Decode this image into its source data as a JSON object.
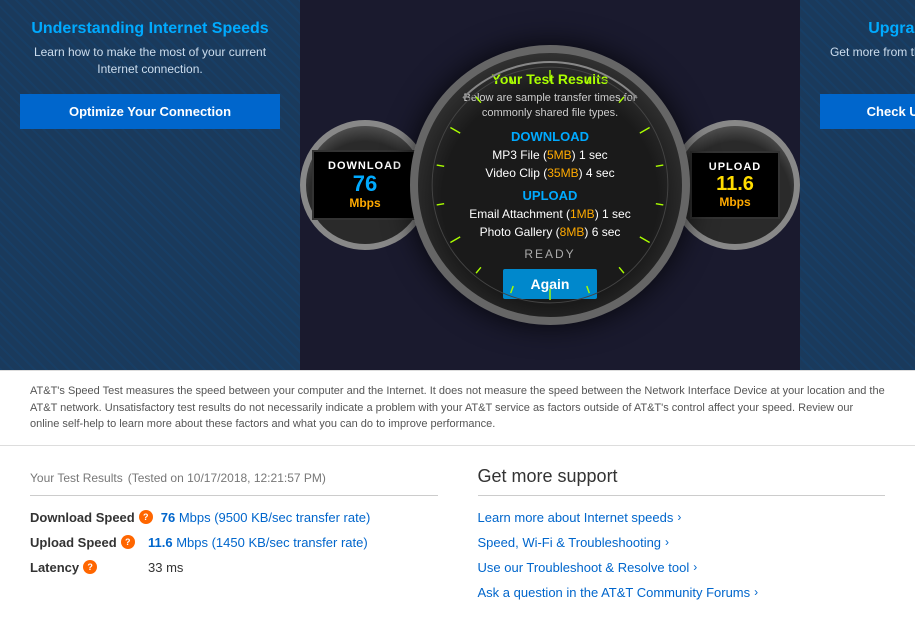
{
  "left_panel": {
    "title": "Understanding Internet Speeds",
    "description": "Learn how to make the most of your current Internet connection.",
    "button_label": "Optimize Your Connection"
  },
  "right_panel": {
    "title": "Upgrade your service",
    "description": "Get more from the Internet and increase your speed.",
    "button_label": "Check Upgrade Availability"
  },
  "gauge": {
    "title": "Your Test Results",
    "subtitle": "Below are sample transfer times for commonly shared file types.",
    "download_label": "DOWNLOAD",
    "download_files": [
      {
        "name": "MP3 File",
        "size": "5MB",
        "time": "1 sec"
      },
      {
        "name": "Video Clip",
        "size": "35MB",
        "time": "4 sec"
      }
    ],
    "upload_label": "UPLOAD",
    "upload_files": [
      {
        "name": "Email Attachment",
        "size": "1MB",
        "time": "1 sec"
      },
      {
        "name": "Photo Gallery",
        "size": "8MB",
        "time": "6 sec"
      }
    ],
    "ready_label": "READY",
    "again_button": "Again",
    "download_speed": "76",
    "download_unit": "Mbps",
    "download_display": "DOWNLOAD",
    "upload_speed": "11.6",
    "upload_unit": "Mbps",
    "upload_display": "UPLOAD"
  },
  "info": {
    "text": "AT&T's Speed Test measures the speed between your computer and the Internet. It does not measure the speed between the Network Interface Device at your location and the AT&T network. Unsatisfactory test results do not necessarily indicate a problem with your AT&T service as factors outside of AT&T's control affect your speed. Review our online self-help to learn more about these factors and what you can do to improve performance."
  },
  "results": {
    "title": "Your Test Results",
    "tested_on": "Tested on 10/17/2018, 12:21:57 PM",
    "rows": [
      {
        "label": "Download Speed",
        "value": "76 Mbps (9500 KB/sec transfer rate)"
      },
      {
        "label": "Upload Speed",
        "value": "11.6 Mbps (1450 KB/sec transfer rate)"
      },
      {
        "label": "Latency",
        "value": "33 ms"
      }
    ]
  },
  "support": {
    "title": "Get more support",
    "links": [
      "Learn more about Internet speeds",
      "Speed, Wi-Fi & Troubleshooting",
      "Use our Troubleshoot & Resolve tool",
      "Ask a question in the AT&T Community Forums"
    ]
  }
}
